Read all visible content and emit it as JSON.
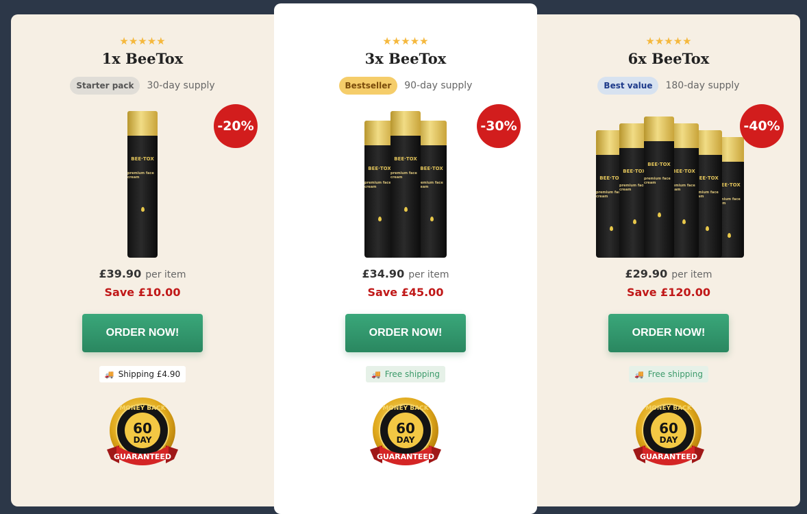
{
  "cards": [
    {
      "stars": "★★★★★",
      "title": "1x BeeTox",
      "pill": "Starter pack",
      "supply": "30-day supply",
      "discount": "-20%",
      "bottle_count": 1,
      "price": "£39.90",
      "per": "per item",
      "save": "Save £10.00",
      "cta": "ORDER NOW!",
      "shipping": "Shipping £4.90"
    },
    {
      "stars": "★★★★★",
      "title": "3x BeeTox",
      "pill": "Bestseller",
      "supply": "90-day supply",
      "discount": "-30%",
      "bottle_count": 3,
      "price": "£34.90",
      "per": "per item",
      "save": "Save £45.00",
      "cta": "ORDER NOW!",
      "shipping": "Free shipping"
    },
    {
      "stars": "★★★★★",
      "title": "6x BeeTox",
      "pill": "Best value",
      "supply": "180-day supply",
      "discount": "-40%",
      "bottle_count": 6,
      "price": "£29.90",
      "per": "per item",
      "save": "Save £120.00",
      "cta": "ORDER NOW!",
      "shipping": "Free shipping"
    }
  ],
  "bottle_label": {
    "brand": "BEE·TOX",
    "sub": "premium face cream"
  },
  "seal": {
    "top": "MONEY BACK",
    "number": "60",
    "unit": "DAY",
    "ribbon": "GUARANTEED"
  },
  "colors": {
    "order_button": "#2f9a6c",
    "save_text": "#c01818",
    "badge": "#d21d1d",
    "star": "#f5b83d"
  }
}
